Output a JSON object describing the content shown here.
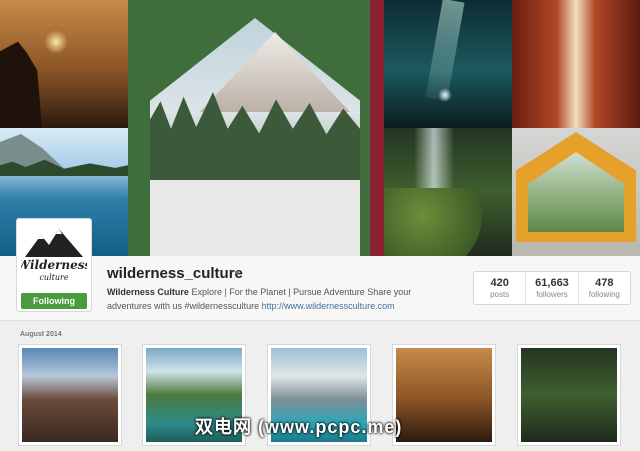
{
  "profile": {
    "username": "wilderness_culture",
    "follow_label": "Following",
    "bio_name": "Wilderness Culture",
    "bio_text": " Explore | For the Planet | Pursue Adventure Share your adventures with us #wildernessculture ",
    "bio_link": "http://www.wildernessculture.com",
    "logo_text_1": "Wilderness",
    "logo_text_2": "culture"
  },
  "stats": [
    {
      "value": "420",
      "label": "posts"
    },
    {
      "value": "61,663",
      "label": "followers"
    },
    {
      "value": "478",
      "label": "following"
    }
  ],
  "feed": {
    "month_label": "August 2014"
  },
  "watermark": "双电网 (www.pcpc.me)",
  "colors": {
    "follow_green": "#4a9a3e",
    "link_blue": "#3f729b"
  },
  "icons": [
    "caret-down-icon",
    "wilderness-culture-logo"
  ]
}
